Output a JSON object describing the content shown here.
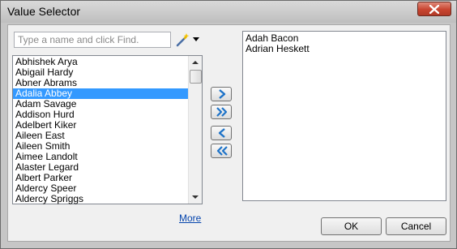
{
  "window": {
    "title": "Value Selector",
    "close_icon": "close-icon",
    "close_color": "#c8442f"
  },
  "search": {
    "placeholder": "Type a name and click Find.",
    "value": "",
    "find_icon": "magic-wand-icon"
  },
  "available_list": {
    "items": [
      "Abhishek Arya",
      "Abigail Hardy",
      "Abner Abrams",
      "Adalia Abbey",
      "Adam Savage",
      "Addison Hurd",
      "Adelbert Kiker",
      "Aileen East",
      "Aileen Smith",
      "Aimee Landolt",
      "Alaster Legard",
      "Albert Parker",
      "Aldercy Speer",
      "Aldercy Spriggs"
    ],
    "selected": "Adalia Abbey",
    "selected_color": "#3399ff"
  },
  "selected_list": {
    "items": [
      "Adah Bacon",
      "Adrian Heskett"
    ]
  },
  "move_buttons": [
    {
      "name": "add-selected-button",
      "icon": "single-right-arrow-icon"
    },
    {
      "name": "add-all-button",
      "icon": "double-right-arrow-icon"
    },
    {
      "name": "remove-selected-button",
      "icon": "single-left-arrow-icon"
    },
    {
      "name": "remove-all-button",
      "icon": "double-left-arrow-icon"
    }
  ],
  "more_link": "More",
  "footer": {
    "ok_label": "OK",
    "cancel_label": "Cancel"
  },
  "accent_color": "#1e73c8"
}
